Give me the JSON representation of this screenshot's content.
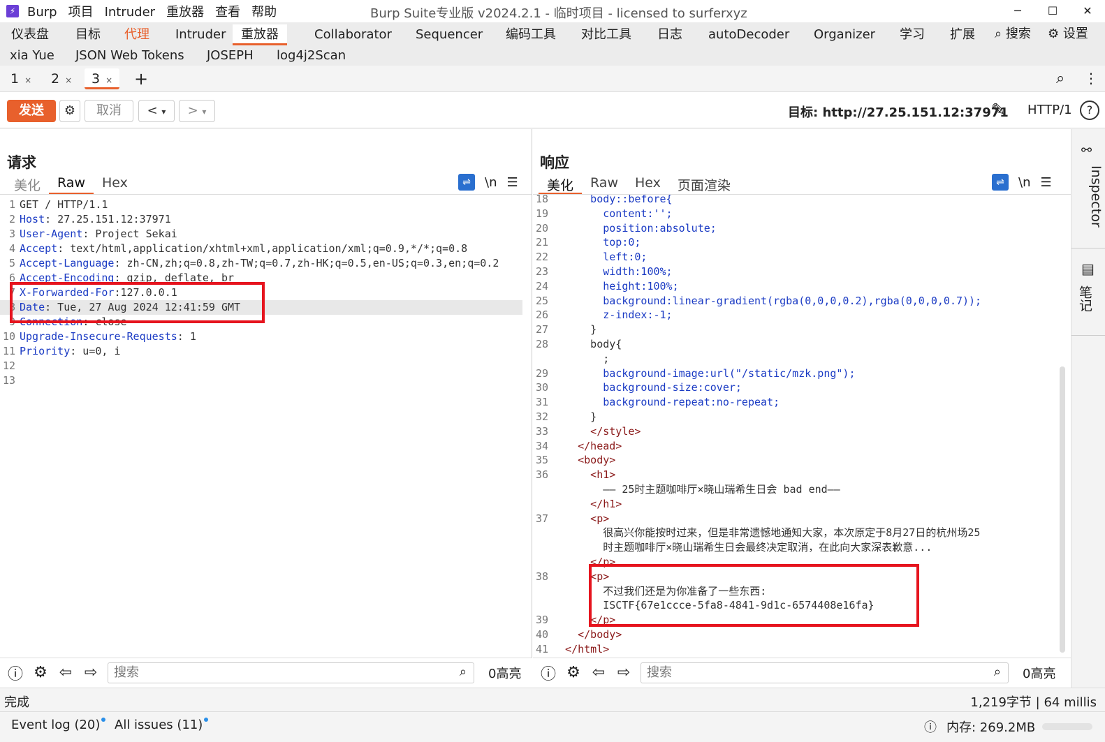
{
  "titlebar": {
    "menu": [
      "Burp",
      "项目",
      "Intruder",
      "重放器",
      "查看",
      "帮助"
    ],
    "title": "Burp Suite专业版  v2024.2.1 - 临时项目 - licensed to surferxyz",
    "min": "─",
    "max": "☐",
    "close": "✕"
  },
  "maintabs": {
    "row1": [
      "仪表盘",
      "目标",
      "代理",
      "Intruder",
      "重放器",
      "Collaborator",
      "Sequencer",
      "编码工具",
      "对比工具",
      "日志",
      "autoDecoder",
      "Organizer",
      "学习",
      "扩展"
    ],
    "search": "搜索",
    "settings": "设置",
    "row2": [
      "xia Yue",
      "JSON Web Tokens",
      "JOSEPH",
      "log4j2Scan"
    ]
  },
  "repeater_tabs": [
    {
      "label": "1",
      "close": "×"
    },
    {
      "label": "2",
      "close": "×"
    },
    {
      "label": "3",
      "close": "×"
    }
  ],
  "add_tab": "+",
  "toolbar": {
    "send": "发送",
    "cancel": "取消",
    "back": "<",
    "fwd": ">",
    "drop": "▾",
    "target_label": "目标: http://27.25.151.12:37971",
    "protocol": "HTTP/1",
    "help": "?"
  },
  "request": {
    "title": "请求",
    "tabs": [
      "美化",
      "Raw",
      "Hex"
    ],
    "newline": "\\n",
    "menu": "☰",
    "lines": [
      {
        "n": "1",
        "k": "",
        "v": "GET / HTTP/1.1"
      },
      {
        "n": "2",
        "k": "Host",
        "v": ": 27.25.151.12:37971"
      },
      {
        "n": "3",
        "k": "User-Agent",
        "v": ": Project Sekai"
      },
      {
        "n": "4",
        "k": "Accept",
        "v": ": text/html,application/xhtml+xml,application/xml;q=0.9,*/*;q=0.8"
      },
      {
        "n": "5",
        "k": "Accept-Language",
        "v": ": zh-CN,zh;q=0.8,zh-TW;q=0.7,zh-HK;q=0.5,en-US;q=0.3,en;q=0.2"
      },
      {
        "n": "6",
        "k": "Accept-Encoding",
        "v": ": gzip, deflate, br"
      },
      {
        "n": "7",
        "k": "X-Forwarded-For",
        "v": ":127.0.0.1"
      },
      {
        "n": "8",
        "k": "Date",
        "v": ": Tue, 27 Aug 2024 12:41:59 GMT"
      },
      {
        "n": "9",
        "k": "Connection",
        "v": ": close"
      },
      {
        "n": "10",
        "k": "Upgrade-Insecure-Requests",
        "v": ": 1"
      },
      {
        "n": "11",
        "k": "Priority",
        "v": ": u=0, i"
      },
      {
        "n": "12",
        "k": "",
        "v": ""
      },
      {
        "n": "13",
        "k": "",
        "v": ""
      }
    ]
  },
  "response": {
    "title": "响应",
    "tabs": [
      "美化",
      "Raw",
      "Hex",
      "页面渲染"
    ],
    "newline": "\\n",
    "menu": "☰",
    "lines": [
      {
        "n": "18",
        "t": "      body::before{"
      },
      {
        "n": "19",
        "t": "        content:'';"
      },
      {
        "n": "20",
        "t": "        position:absolute;"
      },
      {
        "n": "21",
        "t": "        top:0;"
      },
      {
        "n": "22",
        "t": "        left:0;"
      },
      {
        "n": "23",
        "t": "        width:100%;"
      },
      {
        "n": "24",
        "t": "        height:100%;"
      },
      {
        "n": "25",
        "t": "        background:linear-gradient(rgba(0,0,0,0.2),rgba(0,0,0,0.7));"
      },
      {
        "n": "26",
        "t": "        z-index:-1;"
      },
      {
        "n": "27",
        "t": "      }"
      },
      {
        "n": "28",
        "t": "      body{"
      },
      {
        "n": "",
        "t": "        ;"
      },
      {
        "n": "29",
        "t": "        background-image:url(\"/static/mzk.png\");"
      },
      {
        "n": "30",
        "t": "        background-size:cover;"
      },
      {
        "n": "31",
        "t": "        background-repeat:no-repeat;"
      },
      {
        "n": "32",
        "t": "      }"
      },
      {
        "n": "33",
        "t": "      </style>"
      },
      {
        "n": "34",
        "t": "    </head>"
      },
      {
        "n": "35",
        "t": "    <body>"
      },
      {
        "n": "36",
        "t": "      <h1>"
      },
      {
        "n": "",
        "t": "        —— 25时主题咖啡厅×晓山瑞希生日会 bad end——"
      },
      {
        "n": "",
        "t": "      </h1>"
      },
      {
        "n": "37",
        "t": "      <p>"
      },
      {
        "n": "",
        "t": "        很高兴你能按时过来，但是非常遗憾地通知大家，本次原定于8月27日的杭州场25"
      },
      {
        "n": "",
        "t": "        时主题咖啡厅×晓山瑞希生日会最终决定取消，在此向大家深表歉意..."
      },
      {
        "n": "",
        "t": "      </p>"
      },
      {
        "n": "38",
        "t": "      <p>"
      },
      {
        "n": "",
        "t": "        不过我们还是为你准备了一些东西:"
      },
      {
        "n": "",
        "t": "        ISCTF{67e1ccce-5fa8-4841-9d1c-6574408e16fa}"
      },
      {
        "n": "39",
        "t": "      </p>"
      },
      {
        "n": "40",
        "t": "    </body>"
      },
      {
        "n": "41",
        "t": "  </html>"
      }
    ]
  },
  "inspector": {
    "label": "Inspector",
    "notes": "笔记"
  },
  "search": {
    "placeholder": "搜索",
    "highlights": "0高亮"
  },
  "status": {
    "left": "完成",
    "right": "1,219字节 | 64 millis"
  },
  "bottom": {
    "event_log": "Event log (20)",
    "issues": "All issues (11)",
    "memory": "内存: 269.2MB"
  }
}
